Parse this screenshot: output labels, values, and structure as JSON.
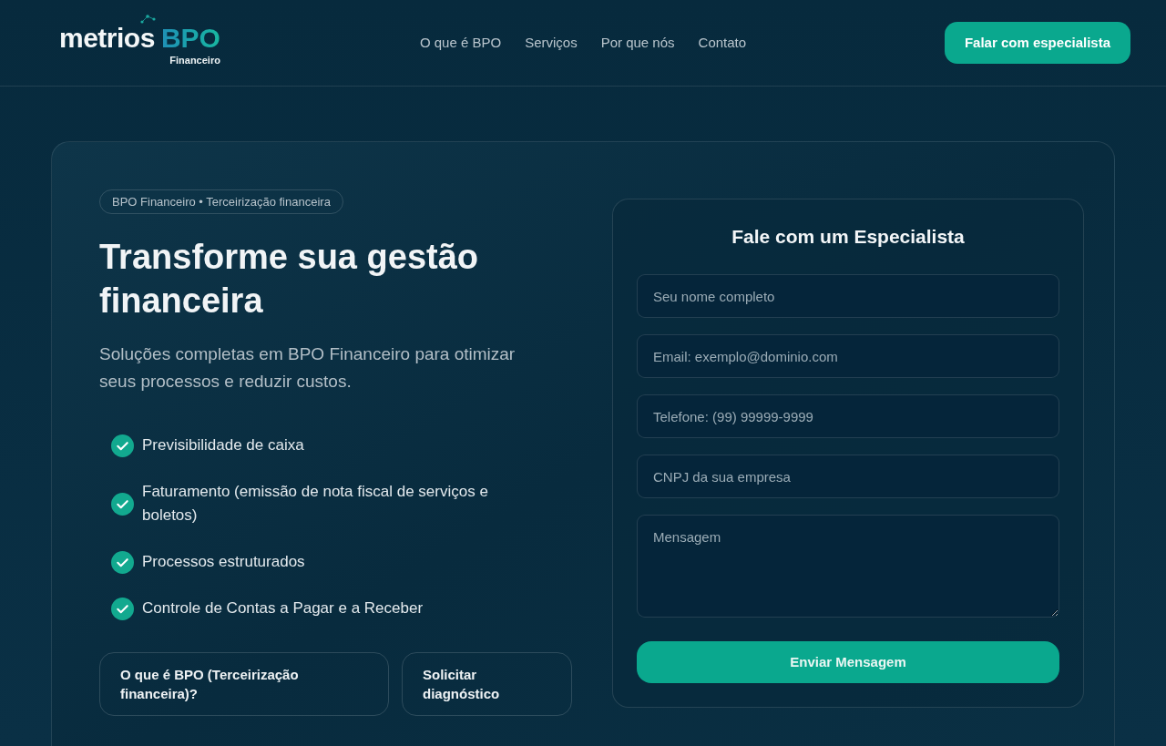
{
  "header": {
    "logo": {
      "wordmark": "metrios",
      "product": "BPO",
      "tagline": "Financeiro"
    },
    "nav": [
      "O que é BPO",
      "Serviços",
      "Por que nós",
      "Contato"
    ],
    "cta": "Falar com especialista"
  },
  "hero": {
    "badge": "BPO Financeiro • Terceirização financeira",
    "title": "Transforme sua gestão financeira",
    "subtitle": "Soluções completas em BPO Financeiro para otimizar seus processos e reduzir custos.",
    "benefits": [
      "Previsibilidade de caixa",
      "Faturamento (emissão de nota fiscal de serviços e boletos)",
      "Processos estruturados",
      "Controle de Contas a Pagar e a Receber"
    ],
    "buttons": [
      "O que é BPO (Terceirização financeira)?",
      "Solicitar diagnóstico"
    ]
  },
  "form": {
    "title": "Fale com um Especialista",
    "fields": [
      {
        "kind": "input",
        "placeholder": "Seu nome completo"
      },
      {
        "kind": "input",
        "placeholder": "Email: exemplo@dominio.com"
      },
      {
        "kind": "input",
        "placeholder": "Telefone: (99) 99999-9999"
      },
      {
        "kind": "input",
        "placeholder": "CNPJ da sua empresa"
      },
      {
        "kind": "textarea",
        "placeholder": "Mensagem"
      }
    ],
    "submit": "Enviar Mensagem"
  }
}
